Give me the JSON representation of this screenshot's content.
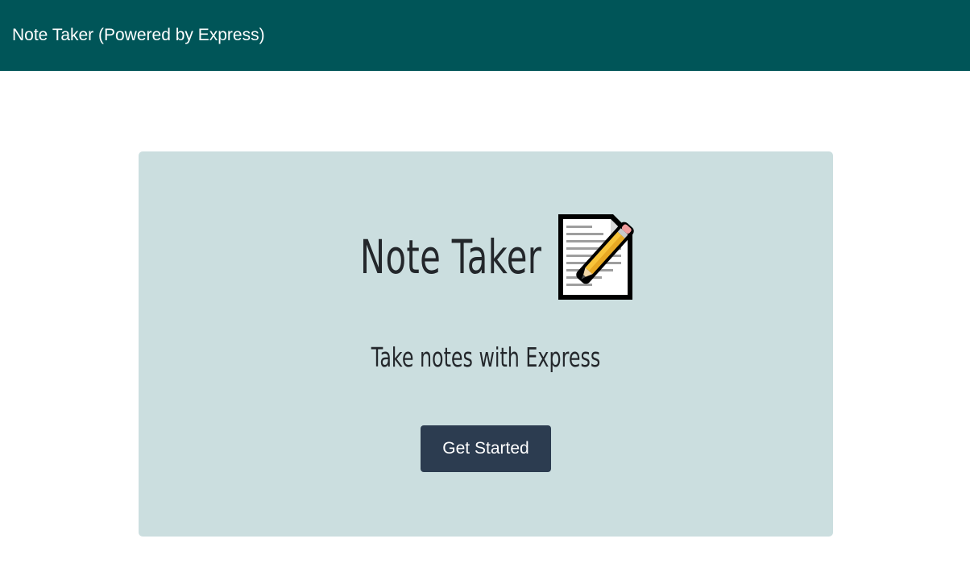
{
  "navbar": {
    "brand": "Note Taker (Powered by Express)"
  },
  "hero": {
    "title": "Note Taker",
    "title_icon": "memo-pencil-icon",
    "subtitle": "Take notes with Express",
    "cta_label": "Get Started"
  },
  "colors": {
    "navbar_bg": "#005558",
    "hero_bg": "#cbdedf",
    "button_bg": "#2c3c50",
    "text_dark": "#23272b"
  }
}
